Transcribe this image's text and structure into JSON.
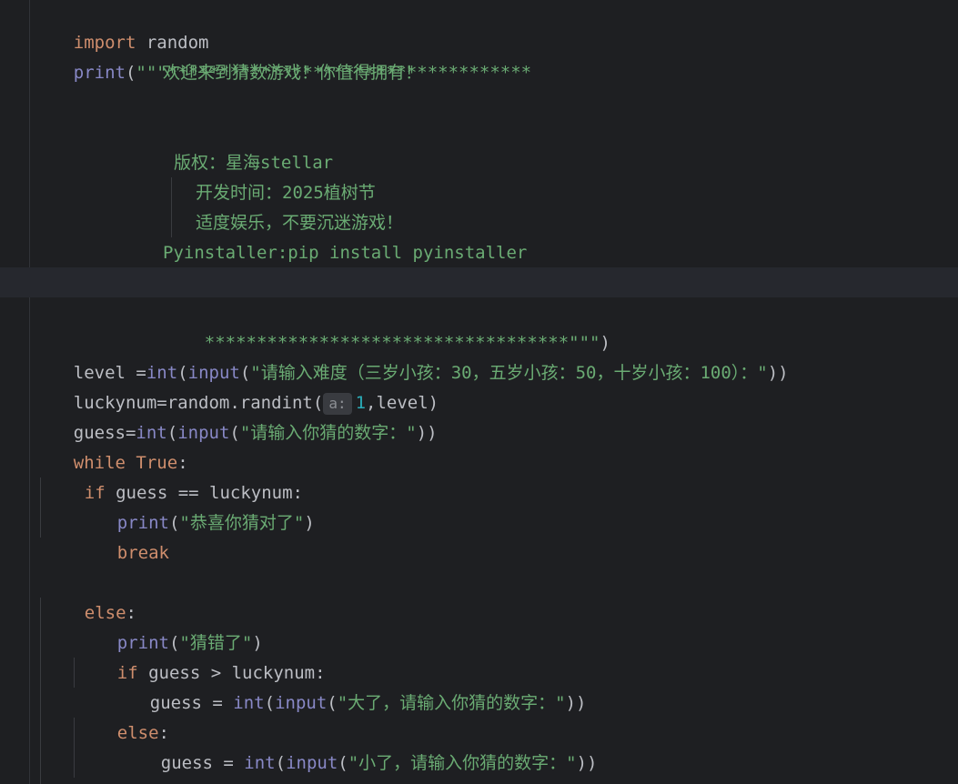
{
  "code": {
    "l1_kw": "import",
    "l1_rest": " random",
    "l2_fn": "print",
    "l2_paren": "(",
    "l2_str": "\"\"\"***********************************",
    "l3_str": "欢迎来到猜数游戏！你值得拥有！",
    "l4_str": "版权：星海stellar",
    "l5_str": "开发时间：2025植树节",
    "l6_str": "适度娱乐，不要沉迷游戏！",
    "l7_str": "Pyinstaller:pip install pyinstaller",
    "l8_str": "***********************************\"\"\"",
    "l8_paren": ")",
    "l9_a": "level =",
    "l9_int": "int",
    "l9_p1": "(",
    "l9_input": "input",
    "l9_p2": "(",
    "l9_str": "\"请输入难度（三岁小孩：30，五岁小孩：50，十岁小孩：100）：\"",
    "l9_end": "))",
    "l10_a": "luckynum=random.randint(",
    "l10_hint": "a:",
    "l10_num": "1",
    "l10_end": ",level)",
    "l11_a": "guess=",
    "l11_int": "int",
    "l11_p1": "(",
    "l11_input": "input",
    "l11_p2": "(",
    "l11_str": "\"请输入你猜的数字：\"",
    "l11_end": "))",
    "l12_kw": "while",
    "l12_sp": " ",
    "l12_true": "True",
    "l12_colon": ":",
    "l13_kw": "if",
    "l13_rest": " guess == luckynum:",
    "l14_fn": "print",
    "l14_p1": "(",
    "l14_str": "\"恭喜你猜对了\"",
    "l14_p2": ")",
    "l15_kw": "break",
    "l16_kw": "else",
    "l16_colon": ":",
    "l17_fn": "print",
    "l17_p1": "(",
    "l17_str": "\"猜错了\"",
    "l17_p2": ")",
    "l18_kw": "if",
    "l18_rest": " guess > luckynum:",
    "l19_a": "guess = ",
    "l19_int": "int",
    "l19_p1": "(",
    "l19_input": "input",
    "l19_p2": "(",
    "l19_str": "\"大了，请输入你猜的数字：\"",
    "l19_end": "))",
    "l20_kw": "else",
    "l20_colon": ":",
    "l21_a": "guess = ",
    "l21_int": "int",
    "l21_p1": "(",
    "l21_input": "input",
    "l21_p2": "(",
    "l21_str": "\"小了，请输入你猜的数字：\"",
    "l21_end": "))"
  },
  "colors": {
    "background": "#1e1f22",
    "keyword": "#cf8e6d",
    "builtin": "#8888c6",
    "string": "#6aab73",
    "number": "#2aacb8",
    "text": "#bcbec4"
  }
}
